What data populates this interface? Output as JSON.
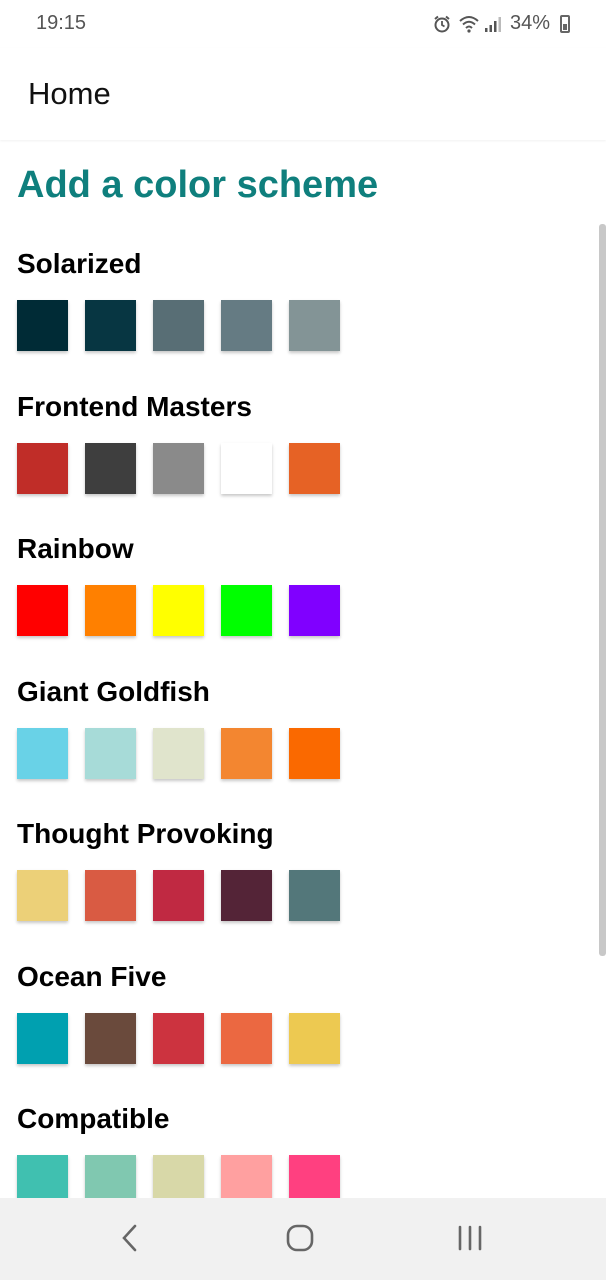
{
  "status": {
    "time": "19:15",
    "battery": "34%",
    "icons": [
      "alarm-icon",
      "wifi-icon",
      "signal-icon",
      "battery-icon"
    ]
  },
  "appbar": {
    "title": "Home"
  },
  "main": {
    "heading": "Add a color scheme",
    "heading_color": "#0f7f7d",
    "schemes": [
      {
        "name": "Solarized",
        "colors": [
          "#002b36",
          "#073642",
          "#586e75",
          "#657b83",
          "#839496"
        ]
      },
      {
        "name": "Frontend Masters",
        "colors": [
          "#c02d28",
          "#3e3e3e",
          "#8a8a8a",
          "#ffffff",
          "#e66225"
        ]
      },
      {
        "name": "Rainbow",
        "colors": [
          "#ff0000",
          "#ff8000",
          "#ffff00",
          "#00ff00",
          "#8000ff"
        ]
      },
      {
        "name": "Giant Goldfish",
        "colors": [
          "#69d2e7",
          "#a7dbd8",
          "#e0e4cc",
          "#f38630",
          "#fa6900"
        ]
      },
      {
        "name": "Thought Provoking",
        "colors": [
          "#ecd078",
          "#d95b43",
          "#c02942",
          "#542437",
          "#53777a"
        ]
      },
      {
        "name": "Ocean Five",
        "colors": [
          "#00a0b0",
          "#6a4a3c",
          "#cc333f",
          "#eb6841",
          "#edc951"
        ]
      },
      {
        "name": "Compatible",
        "colors": [
          "#40c0b0",
          "#80c8b0",
          "#d8d8a8",
          "#ffa0a0",
          "#ff4080"
        ]
      }
    ]
  },
  "navbar": {
    "back_icon": "chevron-left-icon",
    "home_icon": "home-circle-icon",
    "recents_icon": "recents-icon"
  }
}
